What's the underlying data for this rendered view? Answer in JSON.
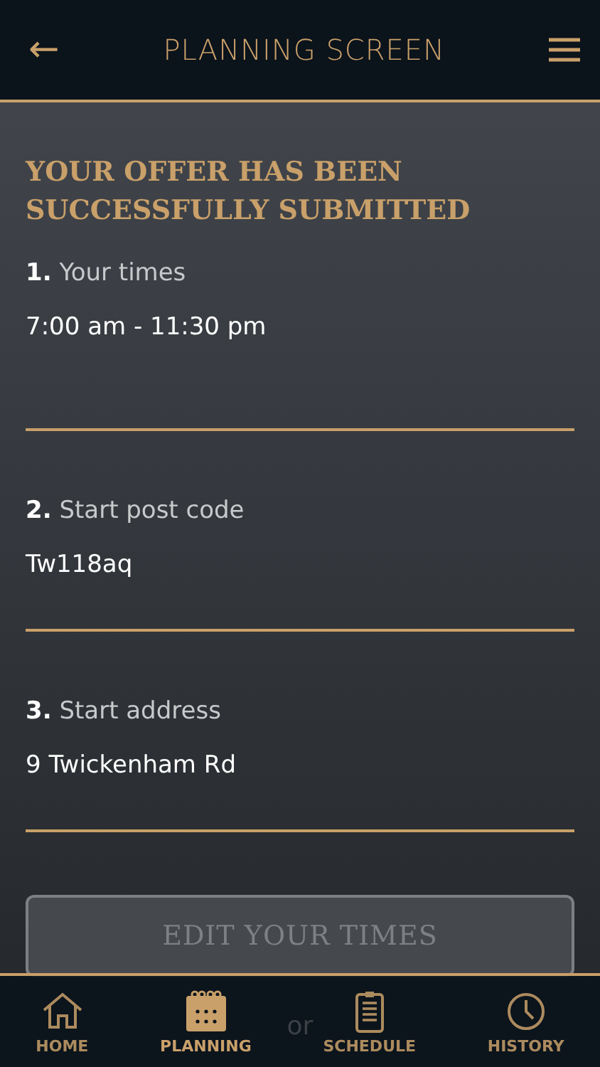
{
  "header": {
    "back": "←",
    "title": "PLANNING SCREEN"
  },
  "heading": "YOUR OFFER HAS BEEN SUCCESSFULLY SUBMITTED",
  "fields": [
    {
      "number": "1.",
      "label": "Your times",
      "value": "7:00 am - 11:30 pm"
    },
    {
      "number": "2.",
      "label": "Start post code",
      "value": "Tw118aq"
    },
    {
      "number": "3.",
      "label": "Start address",
      "value": "9 Twickenham Rd"
    }
  ],
  "edit_button": {
    "label": "EDIT YOUR TIMES",
    "disabled": true
  },
  "separator": "or",
  "tabs": [
    {
      "kind": "home",
      "label": "HOME",
      "selected": false
    },
    {
      "kind": "planning",
      "label": "PLANNING",
      "selected": true
    },
    {
      "kind": "schedule",
      "label": "SCHEDULE",
      "selected": false
    },
    {
      "kind": "history",
      "label": "HISTORY",
      "selected": false
    }
  ]
}
